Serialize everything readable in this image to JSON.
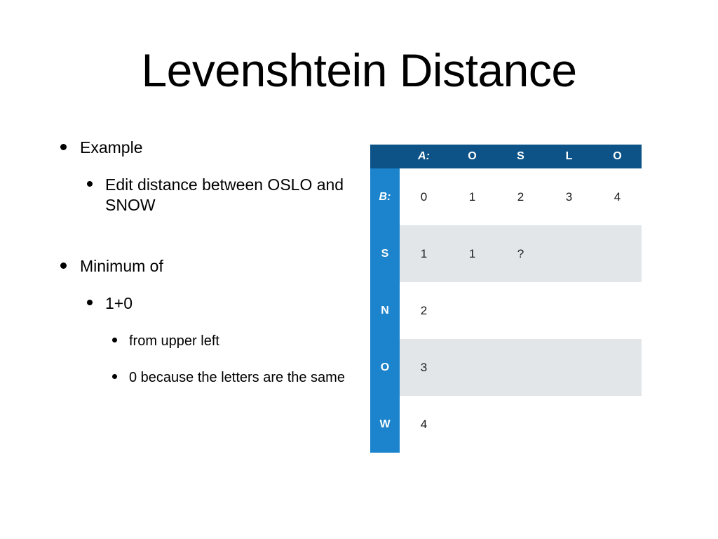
{
  "slide": {
    "title": "Levenshtein Distance",
    "background": "#ffffff"
  },
  "colors": {
    "header_blue": "#0d5387",
    "label_blue": "#1b84cc",
    "row_shade": "#e3e6e9",
    "highlight_red": "#bf3b2b",
    "text": "#000000"
  },
  "bullets": {
    "b1": "Example",
    "b1_1": "Edit distance between OSLO and SNOW",
    "b2": "Minimum of",
    "b2_1": "1+0",
    "b2_1_1": "from upper left",
    "b2_1_2": "0 because the letters are the same"
  },
  "table": {
    "corner_label": "",
    "row_axis_label": "B:",
    "col_axis_label": "A:",
    "columns": [
      "A:",
      "O",
      "S",
      "L",
      "O"
    ],
    "row_labels": [
      "B:",
      "S",
      "N",
      "O",
      "W"
    ],
    "rows": [
      {
        "label": "B:",
        "cells": [
          "0",
          "1",
          "2",
          "3",
          "4"
        ]
      },
      {
        "label": "S",
        "cells": [
          "1",
          "1",
          "?",
          "",
          ""
        ]
      },
      {
        "label": "N",
        "cells": [
          "2",
          "",
          "",
          "",
          ""
        ]
      },
      {
        "label": "O",
        "cells": [
          "3",
          "",
          "",
          "",
          ""
        ]
      },
      {
        "label": "W",
        "cells": [
          "4",
          "",
          "",
          "",
          ""
        ]
      }
    ],
    "highlighted": [
      {
        "row": 0,
        "col": 1,
        "value": "1"
      },
      {
        "row": 1,
        "col": 2,
        "value": "?"
      }
    ]
  },
  "chart_data": {
    "type": "table",
    "title": "Levenshtein Distance matrix: OSLO vs SNOW",
    "col_header": [
      "A:",
      "O",
      "S",
      "L",
      "O"
    ],
    "row_header": [
      "B:",
      "S",
      "N",
      "O",
      "W"
    ],
    "values": [
      [
        "0",
        "1",
        "2",
        "3",
        "4"
      ],
      [
        "1",
        "1",
        "?",
        "",
        ""
      ],
      [
        "2",
        "",
        "",
        "",
        ""
      ],
      [
        "3",
        "",
        "",
        "",
        ""
      ],
      [
        "4",
        "",
        "",
        "",
        ""
      ]
    ],
    "annotations": [
      "1 highlighted red",
      "? highlighted red"
    ]
  }
}
